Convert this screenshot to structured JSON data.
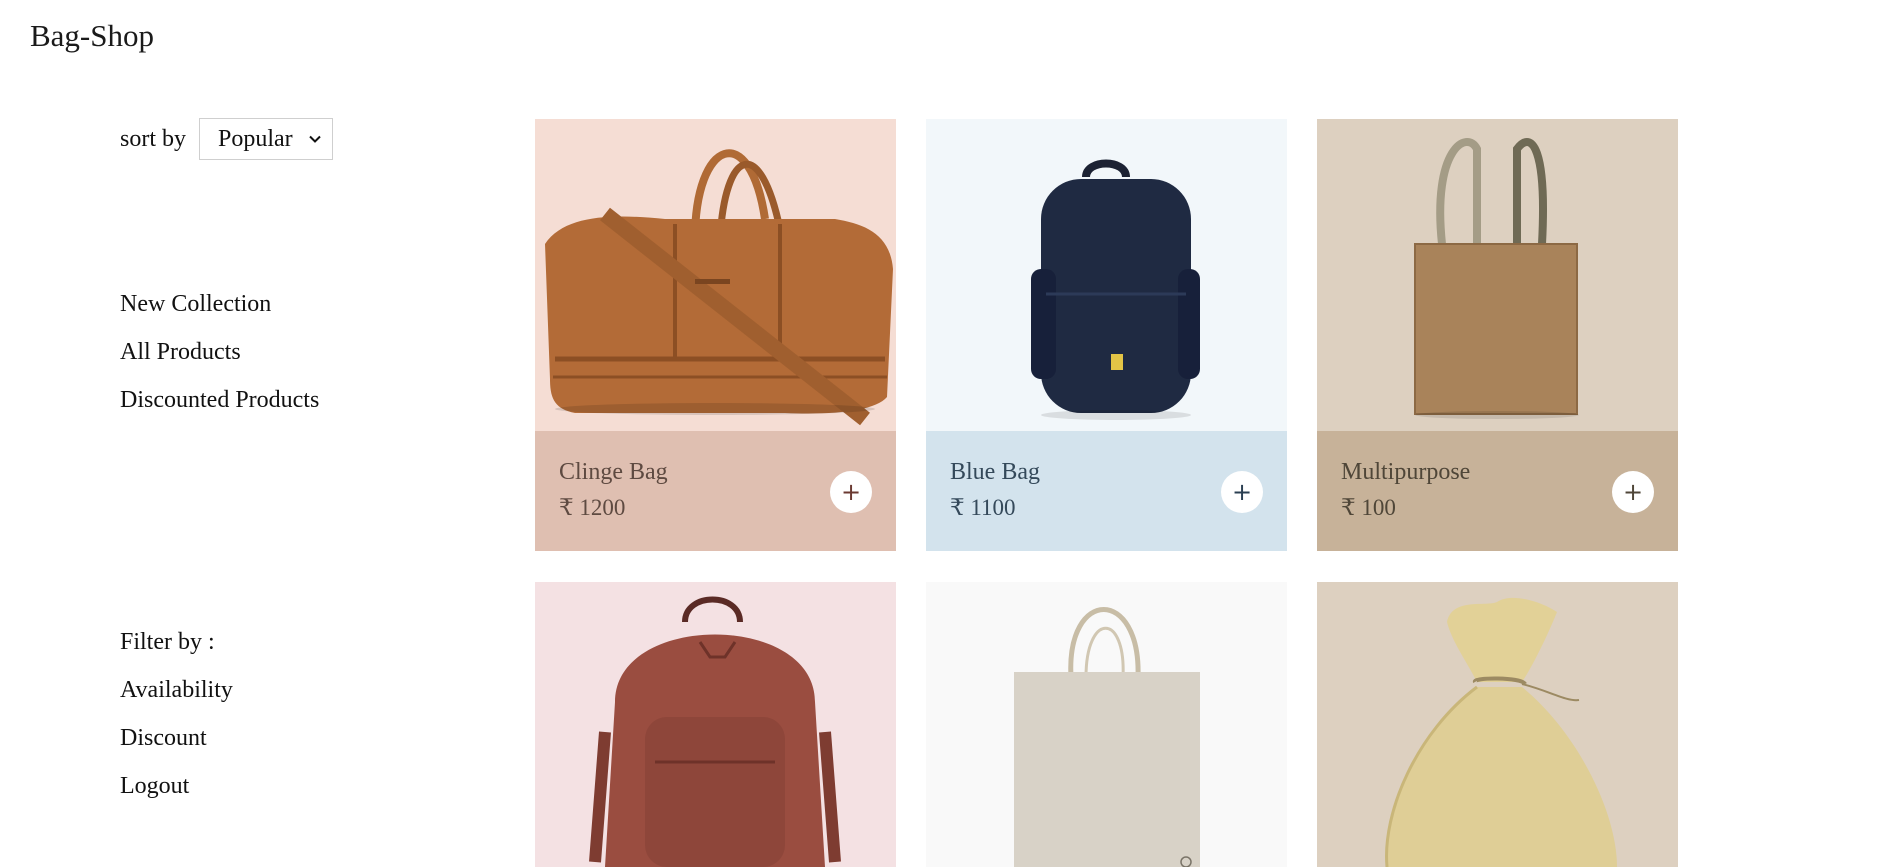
{
  "brand": "Bag-Shop",
  "sort": {
    "label": "sort by",
    "selected": "Popular"
  },
  "nav": {
    "items": [
      {
        "label": "New Collection"
      },
      {
        "label": "All Products"
      },
      {
        "label": "Discounted Products"
      }
    ]
  },
  "filter": {
    "label": "Filter by :",
    "items": [
      {
        "label": "Availability"
      },
      {
        "label": "Discount"
      },
      {
        "label": "Logout"
      }
    ]
  },
  "products": [
    {
      "name": "Clinge Bag",
      "price": "₹ 1200",
      "image": "brown-leather-duffel-bag",
      "bg": "#f5ddd4",
      "panel": "#dfbfb1",
      "text": "#5e4a41",
      "btn": "+"
    },
    {
      "name": "Blue Bag",
      "price": "₹ 1100",
      "image": "navy-backpack",
      "bg": "#f2f7fa",
      "panel": "#d3e3ed",
      "text": "#34495a",
      "btn": "+"
    },
    {
      "name": "Multipurpose",
      "price": "₹ 100",
      "image": "jute-tote-bag",
      "bg": "#ddd0c0",
      "panel": "#c7b299",
      "text": "#4f4638",
      "btn": "+"
    },
    {
      "image": "red-leather-backpack",
      "bg": "#f4e1e3"
    },
    {
      "image": "canvas-tote-bag",
      "bg": "#f9f9f9"
    },
    {
      "image": "burlap-drawstring-pouch",
      "bg": "#ddd0c0"
    }
  ]
}
